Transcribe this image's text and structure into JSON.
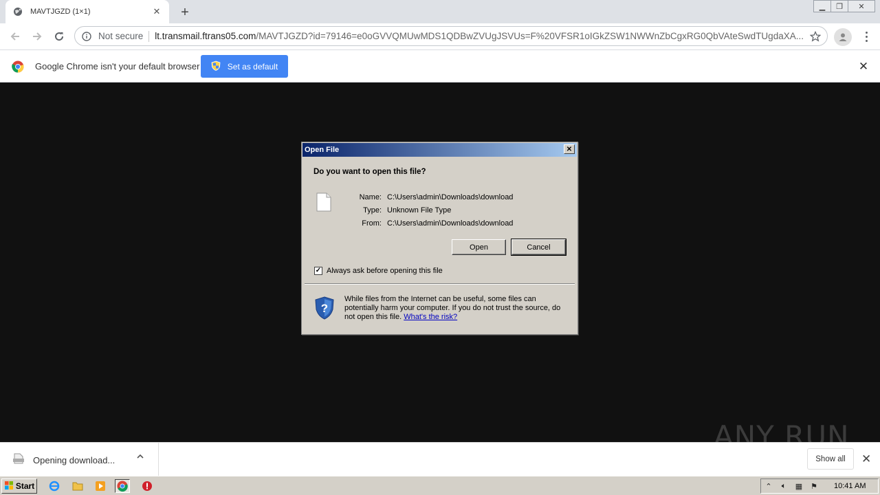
{
  "tab": {
    "title": "MAVTJGZD (1×1)"
  },
  "toolbar": {
    "security_label": "Not secure",
    "url_host": "lt.transmail.ftrans05.com",
    "url_rest": "/MAVTJGZD?id=79146=e0oGVVQMUwMDS1QDBwZVUgJSVUs=F%20VFSR1oIGkZSW1NWWnZbCgxRG0QbVAteSwdTUgdaXA..."
  },
  "infobar": {
    "message": "Google Chrome isn't your default browser",
    "button_label": "Set as default"
  },
  "dialog": {
    "title": "Open File",
    "question": "Do you want to open this file?",
    "name_label": "Name:",
    "name_value": "C:\\Users\\admin\\Downloads\\download",
    "type_label": "Type:",
    "type_value": "Unknown File Type",
    "from_label": "From:",
    "from_value": "C:\\Users\\admin\\Downloads\\download",
    "open_label": "Open",
    "cancel_label": "Cancel",
    "checkbox_label": "Always ask before opening this file",
    "checkbox_checked": true,
    "warning_text": "While files from the Internet can be useful, some files can potentially harm your computer. If you do not trust the source, do not open this file.",
    "risk_link": "What's the risk?"
  },
  "download": {
    "status": "Opening download...",
    "show_all": "Show all"
  },
  "taskbar": {
    "start_label": "Start",
    "clock": "10:41 AM"
  },
  "watermark": {
    "text": "ANY RUN"
  },
  "colors": {
    "accent_blue": "#4285f4",
    "dialog_bg": "#d4d0c8",
    "titlebar_start": "#0a246a",
    "titlebar_end": "#a6caf0"
  },
  "icons": [
    "globe-icon",
    "close-icon",
    "plus-icon",
    "back-arrow-icon",
    "forward-arrow-icon",
    "reload-icon",
    "info-icon",
    "star-icon",
    "profile-icon",
    "chrome-logo-icon",
    "shield-icon",
    "file-icon",
    "security-shield-icon",
    "download-file-icon",
    "chevron-up-icon",
    "windows-flag-icon",
    "ie-icon",
    "folder-icon",
    "media-player-icon",
    "chrome-icon",
    "stop-icon"
  ]
}
